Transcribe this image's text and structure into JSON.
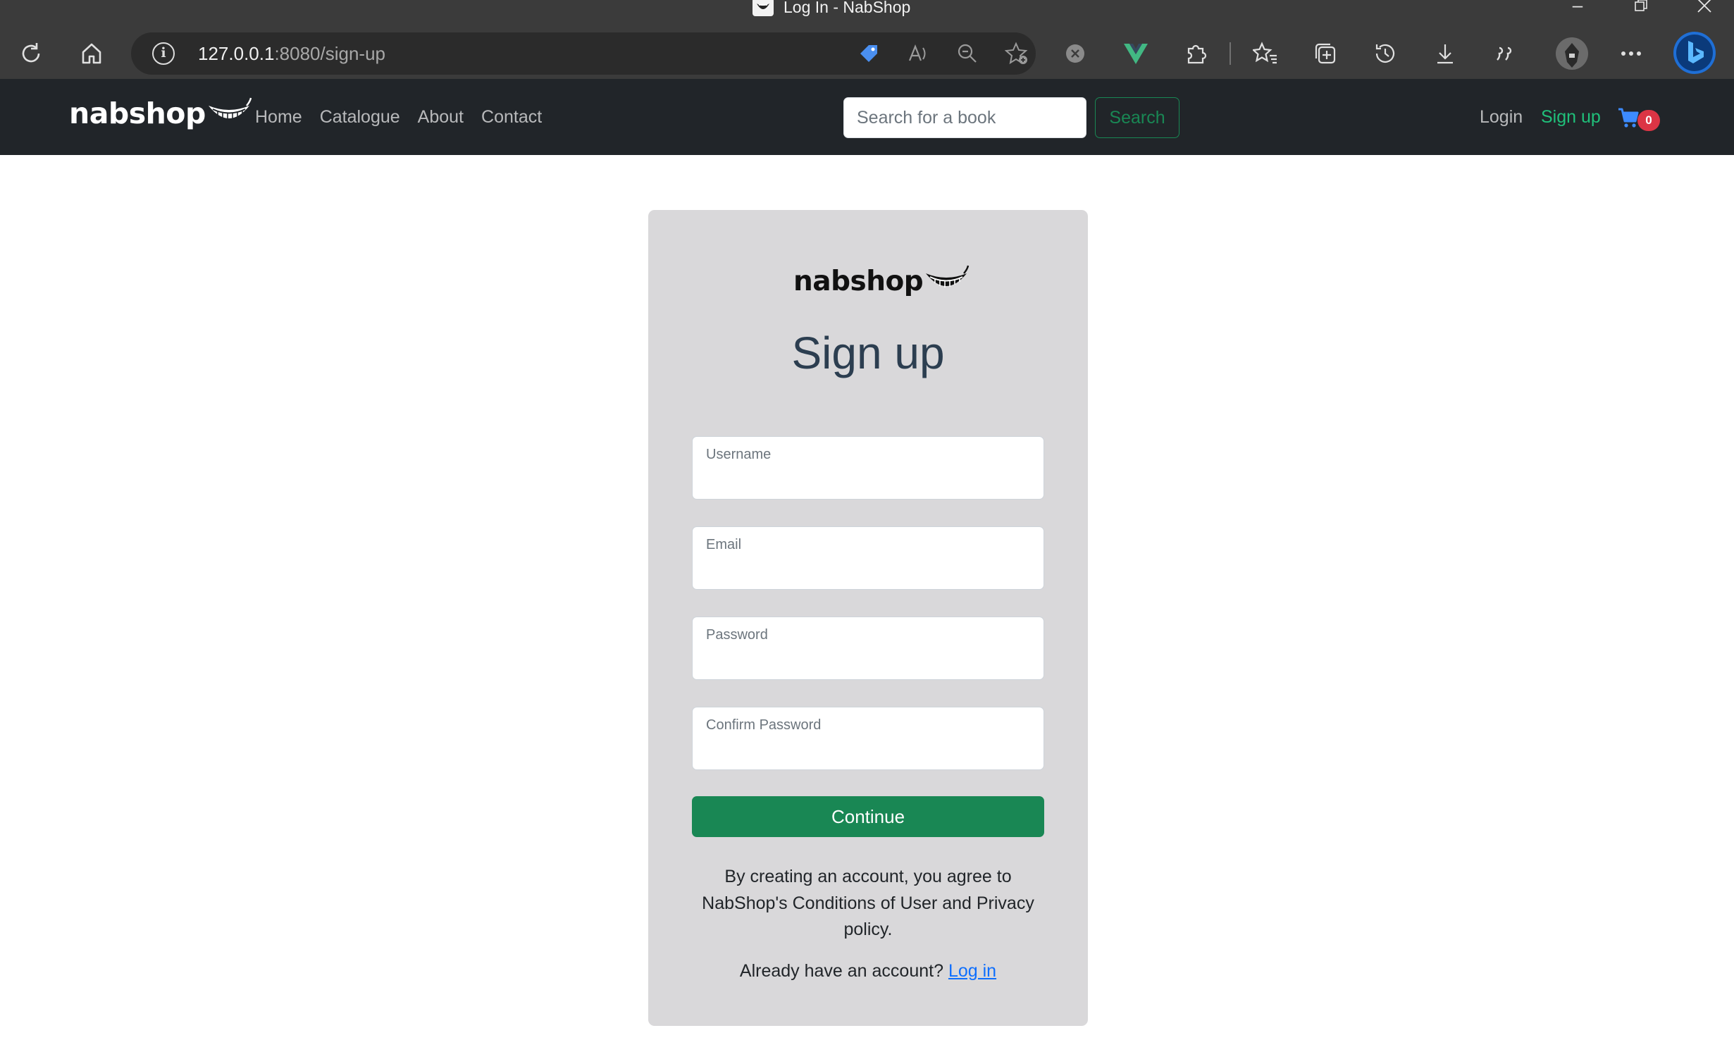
{
  "browser": {
    "tab_title": "Log In - NabShop",
    "url_host": "127.0.0.1",
    "url_rest": ":8080/sign-up"
  },
  "navbar": {
    "brand": "nabshop",
    "links": [
      "Home",
      "Catalogue",
      "About",
      "Contact"
    ],
    "search_placeholder": "Search for a book",
    "search_button": "Search",
    "login": "Login",
    "signup": "Sign up",
    "cart_count": "0"
  },
  "card": {
    "brand": "nabshop",
    "title": "Sign up",
    "fields": [
      {
        "label": "Username",
        "value": ""
      },
      {
        "label": "Email",
        "value": ""
      },
      {
        "label": "Password",
        "value": ""
      },
      {
        "label": "Confirm Password",
        "value": ""
      }
    ],
    "continue": "Continue",
    "terms": "By creating an account, you agree to NabShop's Conditions of User and Privacy policy.",
    "already_text": "Already have an account?",
    "login_link": "Log in"
  },
  "colors": {
    "navbar_bg": "#212529",
    "accent_green": "#198754",
    "signup_green": "#20c07a",
    "badge_red": "#dc3545",
    "card_bg": "#d9d8da",
    "link_blue": "#0d6efd"
  }
}
